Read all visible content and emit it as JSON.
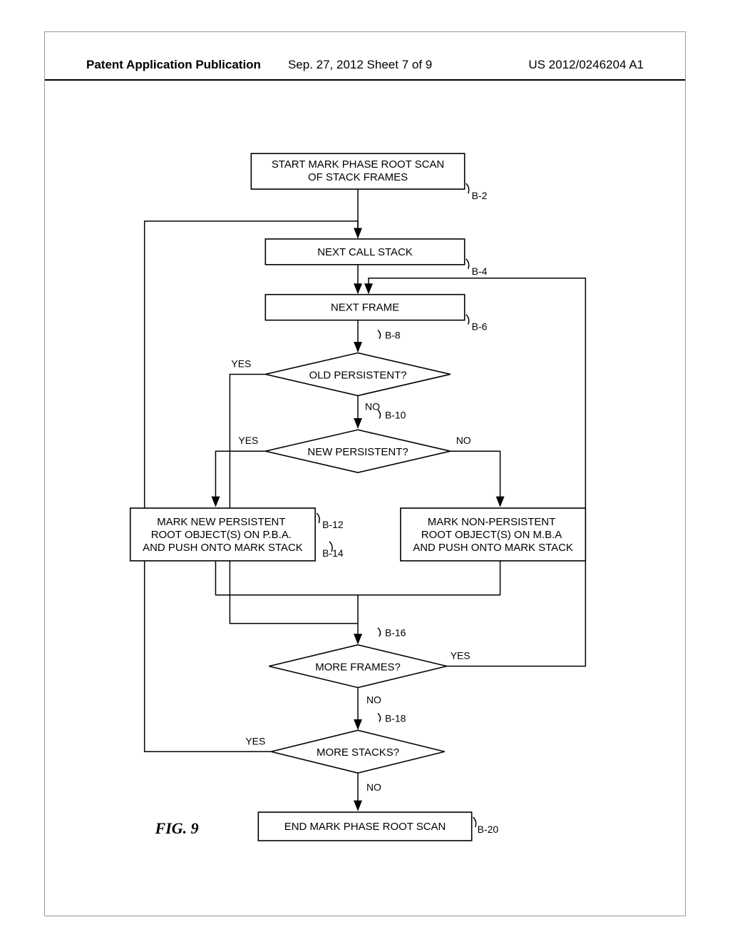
{
  "header": {
    "left": "Patent Application Publication",
    "mid": "Sep. 27, 2012  Sheet 7 of 9",
    "right": "US 2012/0246204 A1"
  },
  "nodes": {
    "b2": "START MARK PHASE ROOT SCAN OF STACK FRAMES",
    "b4": "NEXT CALL STACK",
    "b6": "NEXT FRAME",
    "b8": "OLD PERSISTENT?",
    "b10": "NEW PERSISTENT?",
    "b12": "MARK NEW PERSISTENT ROOT OBJECT(S) ON P.B.A. AND PUSH ONTO MARK STACK",
    "b14": "MARK NON-PERSISTENT ROOT OBJECT(S) ON M.B.A AND PUSH ONTO MARK STACK",
    "b16": "MORE FRAMES?",
    "b18": "MORE STACKS?",
    "b20": "END MARK PHASE ROOT SCAN"
  },
  "refs": {
    "b2": "B-2",
    "b4": "B-4",
    "b6": "B-6",
    "b8": "B-8",
    "b10": "B-10",
    "b12": "B-12",
    "b14": "B-14",
    "b16": "B-16",
    "b18": "B-18",
    "b20": "B-20"
  },
  "labels": {
    "yes": "YES",
    "no": "NO"
  },
  "figure": "FIG. 9"
}
